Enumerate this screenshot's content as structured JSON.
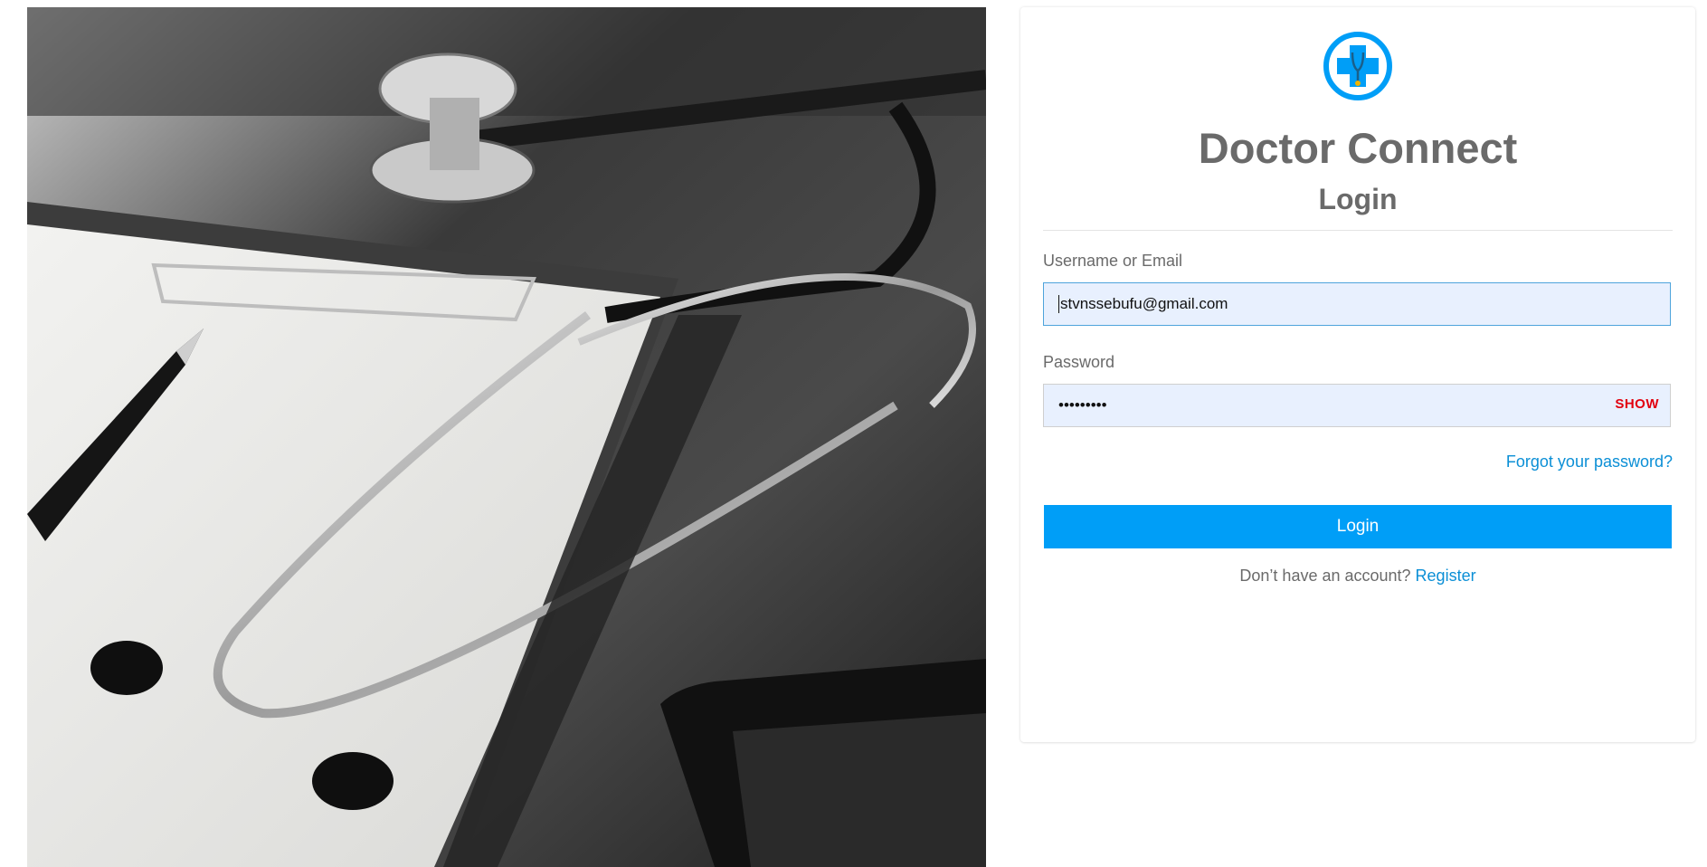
{
  "brand": {
    "name": "Doctor Connect",
    "accent_color": "#009ef7",
    "logo_icon": "medical-cross-stethoscope-icon"
  },
  "hero": {
    "image": "stethoscope-clipboard-pen-tablet-photo"
  },
  "login_form": {
    "title": "Login",
    "username": {
      "label": "Username or Email",
      "value": "stvnssebufu@gmail.com"
    },
    "password": {
      "label": "Password",
      "value": "•••••••••",
      "toggle_label": "SHOW"
    },
    "forgot_link": "Forgot your password?",
    "submit_label": "Login",
    "register_prompt": "Don’t have an account?",
    "register_link": "Register"
  }
}
